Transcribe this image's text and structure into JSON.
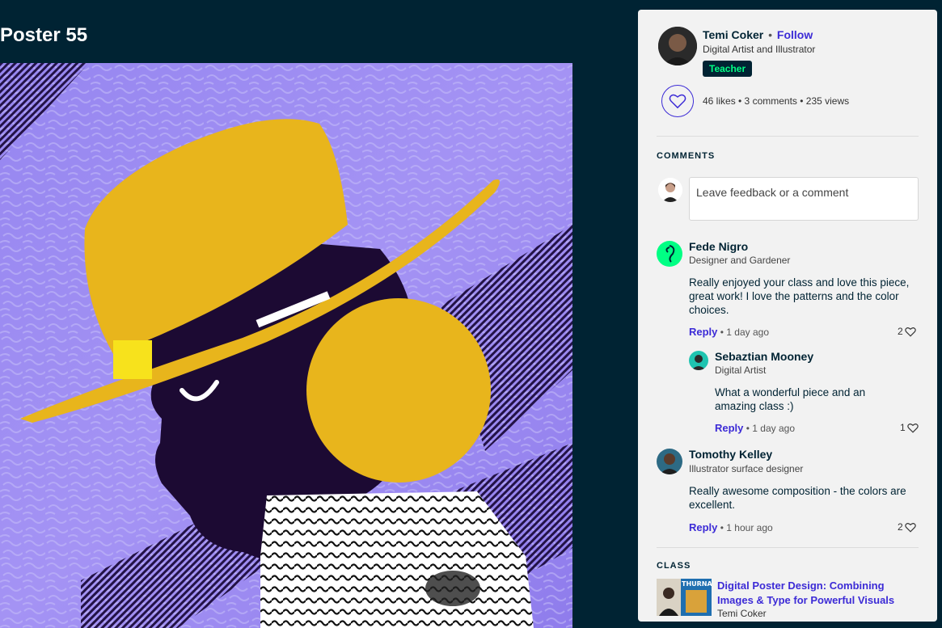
{
  "poster": {
    "title": "Poster 55"
  },
  "author": {
    "name": "Temi Coker",
    "separator": "•",
    "follow_label": "Follow",
    "subtitle": "Digital Artist and Illustrator",
    "badge": "Teacher"
  },
  "stats": {
    "text": "46 likes • 3 comments • 235 views"
  },
  "comments_section": {
    "label": "COMMENTS",
    "placeholder": "Leave feedback or a comment",
    "items": [
      {
        "name": "Fede Nigro",
        "subtitle": "Designer and Gardener",
        "text": "Really enjoyed your class and love this piece, great work! I love the patterns and the color choices.",
        "reply_label": "Reply",
        "time": "• 1 day ago",
        "likes": "2"
      },
      {
        "name": "Sebaztian Mooney",
        "subtitle": "Digital Artist",
        "text": "What a wonderful piece and an amazing class :)",
        "reply_label": "Reply",
        "time": "• 1 day ago",
        "likes": "1"
      },
      {
        "name": "Tomothy Kelley",
        "subtitle": "Illustrator surface designer",
        "text": "Really awesome composition - the colors are excellent.",
        "reply_label": "Reply",
        "time": "• 1 hour ago",
        "likes": "2"
      }
    ]
  },
  "class_section": {
    "label": "CLASS",
    "title": "Digital Poster Design: Combining Images & Type for Powerful Visuals",
    "author": "Temi Coker",
    "thumb_text": "THURNA"
  },
  "colors": {
    "background": "#002333",
    "panel": "#f2f2f2",
    "accent": "#3c2bd6",
    "badge_text": "#00ff84",
    "hat": "#e8b51c",
    "purple": "#9b8cf2"
  }
}
